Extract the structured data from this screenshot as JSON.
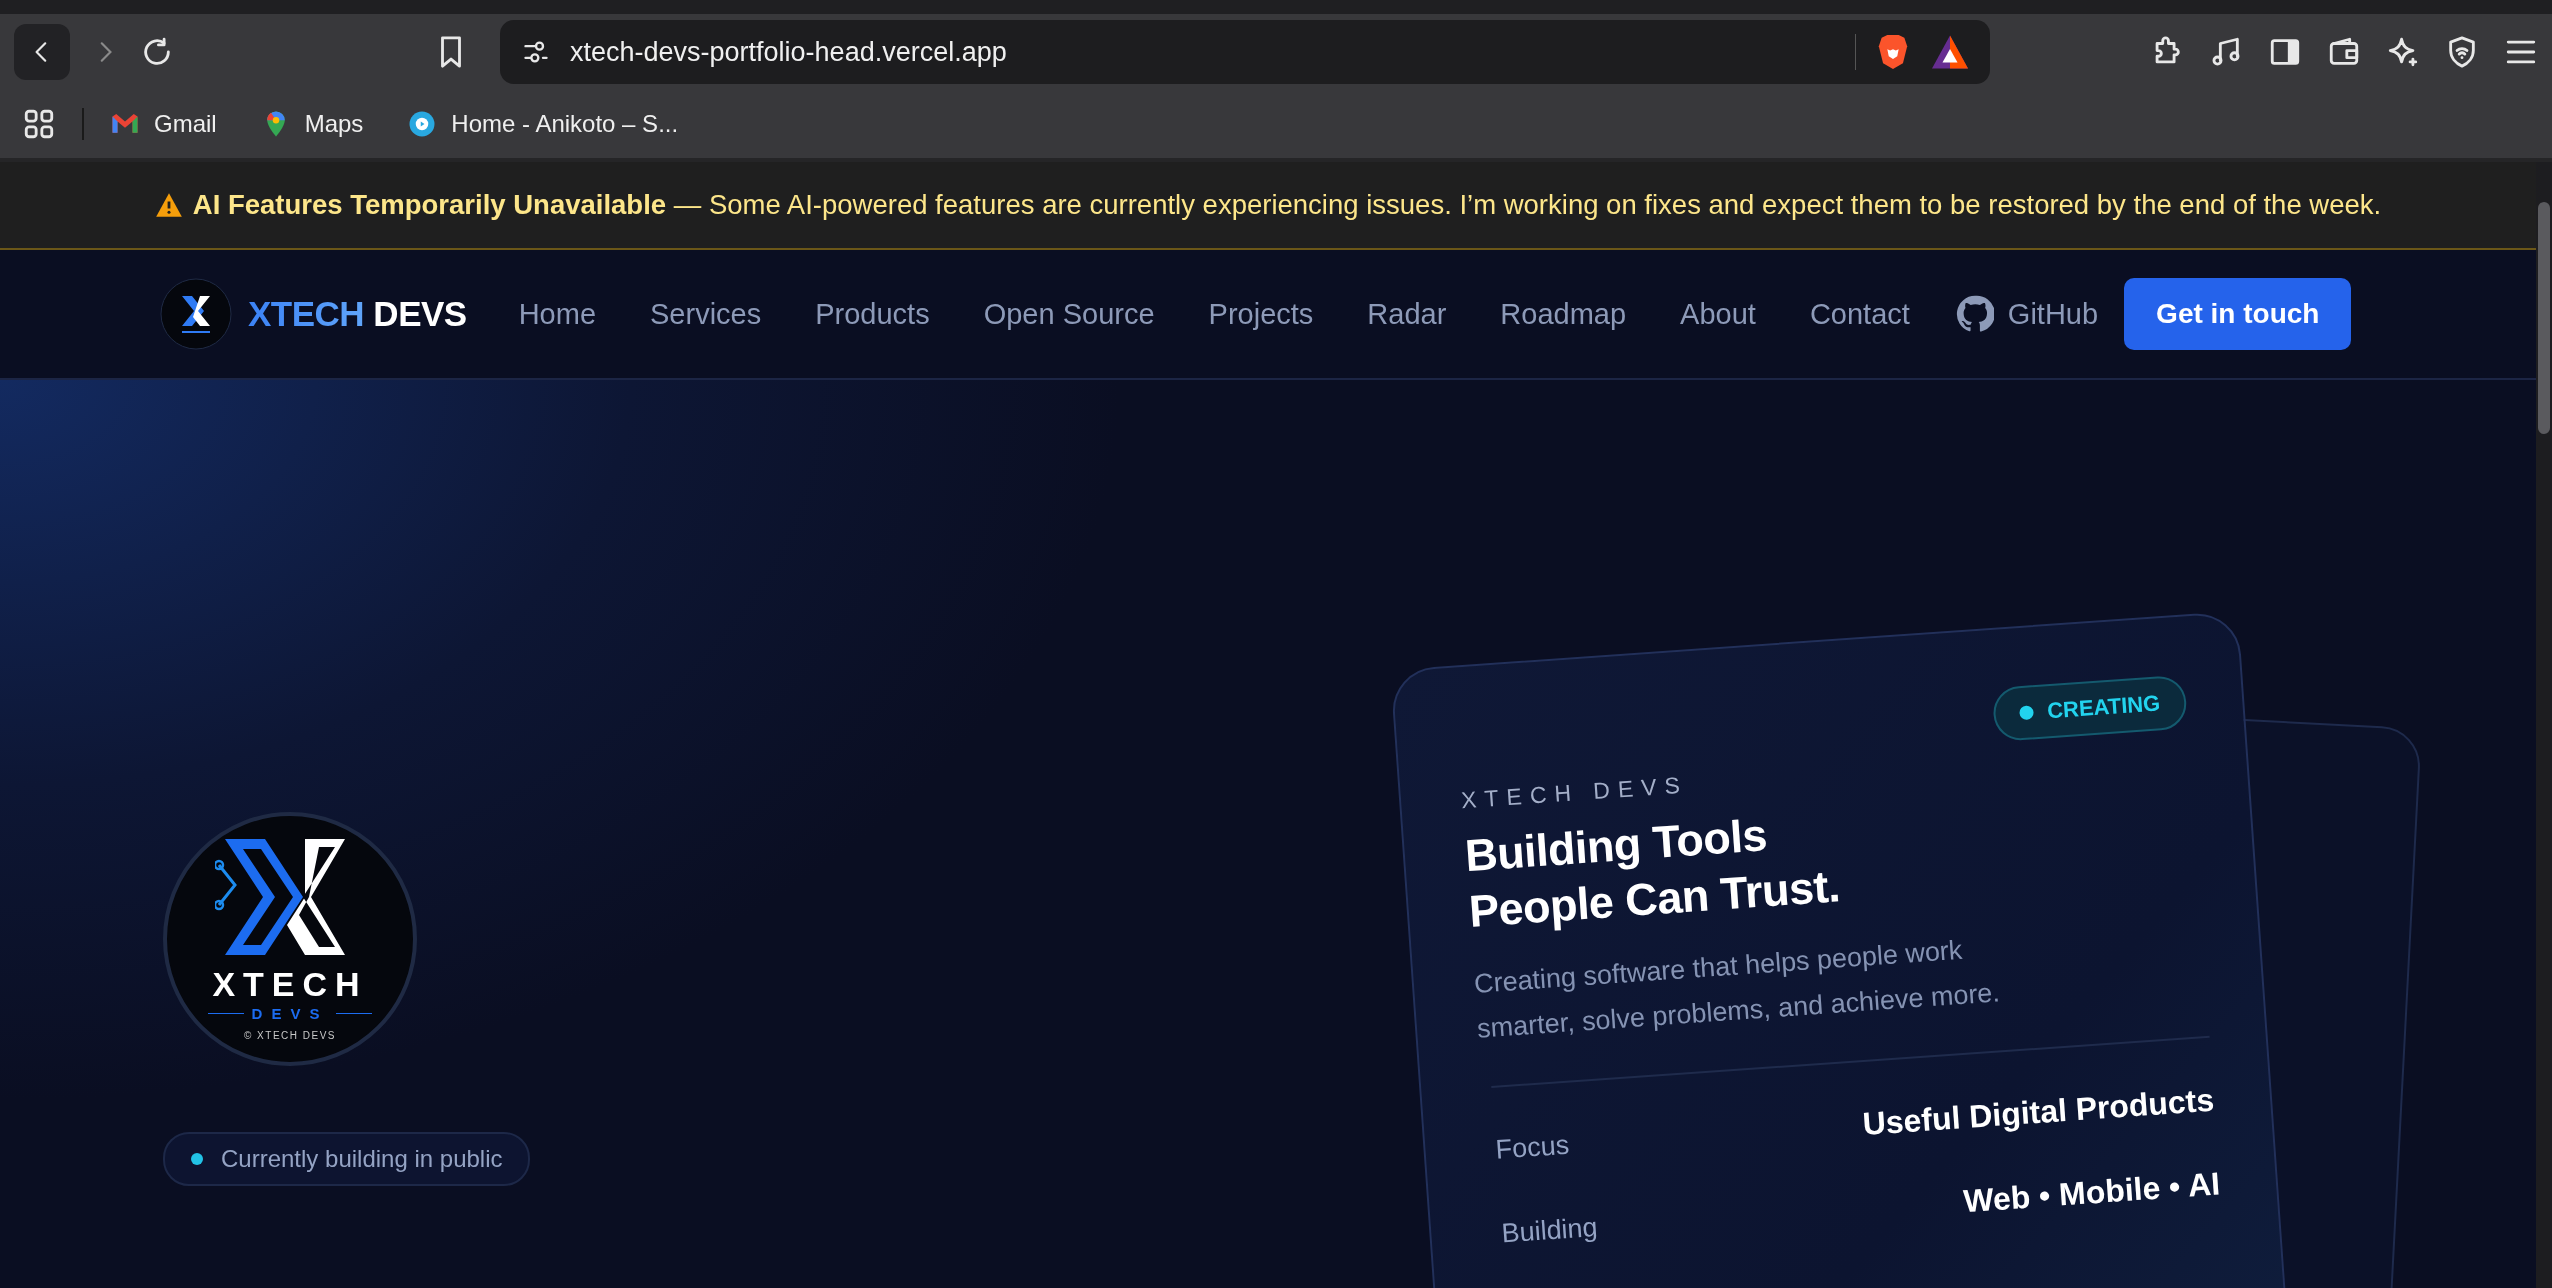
{
  "browser": {
    "url": "xtech-devs-portfolio-head.vercel.app",
    "bookmarks": [
      {
        "kind": "gmail",
        "label": "Gmail"
      },
      {
        "kind": "maps",
        "label": "Maps"
      },
      {
        "kind": "site",
        "label": "Home - Anikoto – S..."
      }
    ]
  },
  "banner": {
    "message": "**AI Features Temporarily Unavailable** — Some AI-powered features are currently experiencing issues. I’m working on fixes and expect them to be restored by the end of the week."
  },
  "nav": {
    "brand_first": "XTECH",
    "brand_second": "DEVS",
    "links": [
      "Home",
      "Services",
      "Products",
      "Open Source",
      "Projects",
      "Radar",
      "Roadmap",
      "About",
      "Contact"
    ],
    "github": "GitHub",
    "cta": "Get in touch"
  },
  "hero": {
    "logo": {
      "wordmark": "XTECH",
      "sub": "DEVS",
      "copyright": "© XTECH DEVS"
    },
    "badge": "Currently building in public",
    "card": {
      "eyebrow": "XTECH DEVS",
      "status": "CREATING",
      "title": [
        "Building Tools",
        "People Can Trust."
      ],
      "description": "Creating software that helps people work smarter, solve problems, and achieve more.",
      "rows": [
        {
          "label": "Focus",
          "value": "Useful Digital Products"
        },
        {
          "label": "Building",
          "value": "Web • Mobile • AI"
        }
      ]
    }
  }
}
